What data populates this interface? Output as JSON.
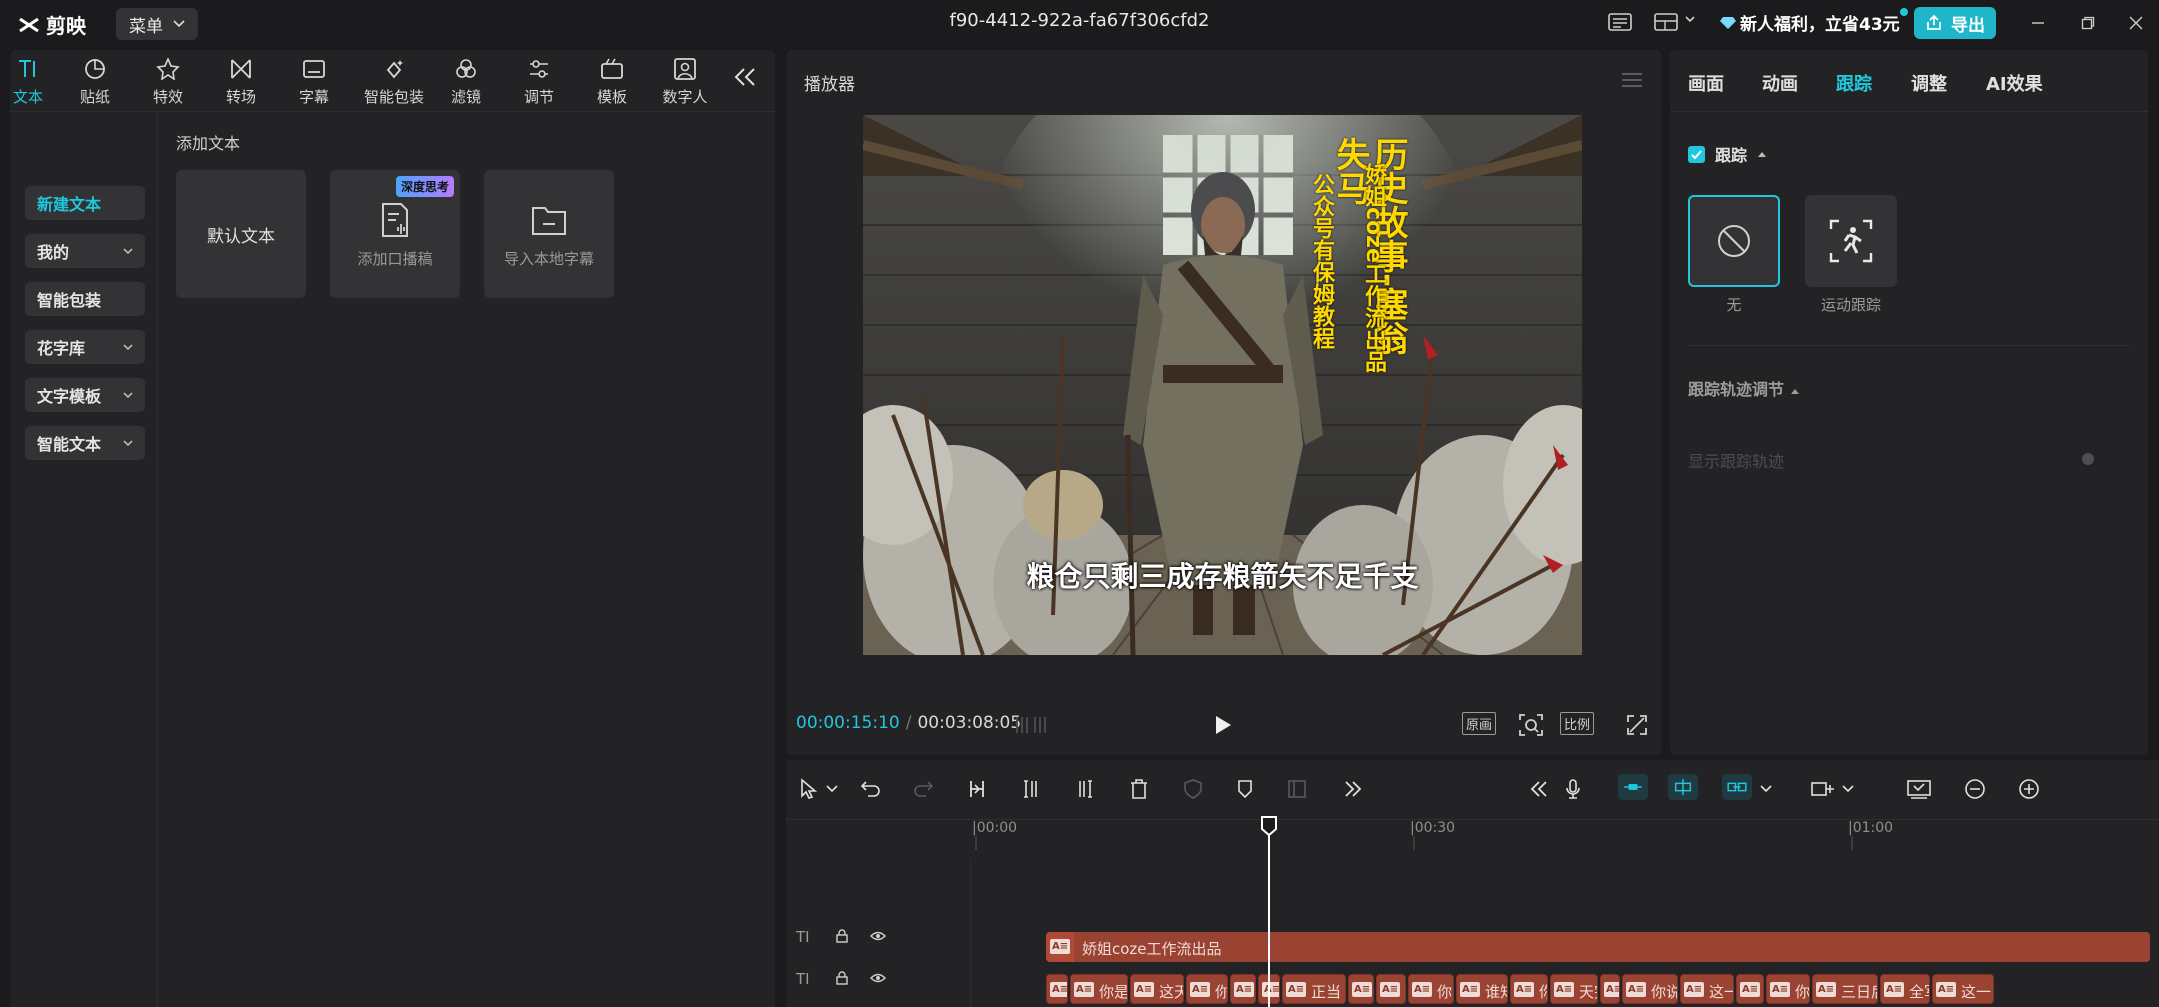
{
  "titlebar": {
    "app_name": "剪映",
    "menu_label": "菜单",
    "project_title": "f90-4412-922a-fa67f306cfd2",
    "welfare_text": "新人福利，立省43元",
    "export_label": "导出"
  },
  "tools": [
    {
      "label": "文本",
      "icon": "text-icon",
      "active": true
    },
    {
      "label": "贴纸",
      "icon": "sticker-icon"
    },
    {
      "label": "特效",
      "icon": "effects-icon"
    },
    {
      "label": "转场",
      "icon": "transition-icon"
    },
    {
      "label": "字幕",
      "icon": "subtitle-icon"
    },
    {
      "label": "智能包装",
      "icon": "smart-pack-icon"
    },
    {
      "label": "滤镜",
      "icon": "filter-icon"
    },
    {
      "label": "调节",
      "icon": "adjust-icon"
    },
    {
      "label": "模板",
      "icon": "template-icon"
    },
    {
      "label": "数字人",
      "icon": "digital-human-icon"
    }
  ],
  "categories": [
    {
      "label": "新建文本",
      "active": true
    },
    {
      "label": "我的",
      "dropdown": true
    },
    {
      "label": "智能包装"
    },
    {
      "label": "花字库",
      "dropdown": true
    },
    {
      "label": "文字模板",
      "dropdown": true
    },
    {
      "label": "智能文本",
      "dropdown": true
    }
  ],
  "content": {
    "section_title": "添加文本",
    "cards": [
      {
        "label": "默认文本"
      },
      {
        "label": "添加口播稿",
        "badge": "深度思考"
      },
      {
        "label": "导入本地字幕"
      }
    ]
  },
  "player": {
    "title": "播放器",
    "current_time": "00:00:15:10",
    "total_time": "00:03:08:05",
    "original_label": "原画",
    "ratio_label": "比例",
    "video": {
      "title_main": "历史故事-塞翁失马",
      "title_side1": "娇姐coze工作流出品",
      "title_side2": "公众号有保姆教程",
      "subtitle": "粮仓只剩三成存粮箭矢不足千支"
    }
  },
  "right_panel": {
    "tabs": [
      {
        "label": "画面"
      },
      {
        "label": "动画"
      },
      {
        "label": "跟踪",
        "active": true
      },
      {
        "label": "调整"
      },
      {
        "label": "AI效果"
      }
    ],
    "tracking_label": "跟踪",
    "options": [
      {
        "label": "无",
        "selected": true
      },
      {
        "label": "运动跟踪"
      }
    ],
    "track_adjust_title": "跟踪轨迹调节",
    "show_track_label": "显示跟踪轨迹"
  },
  "timeline": {
    "ruler_labels": [
      "00:00",
      "00:30",
      "01:00"
    ],
    "track1_clip": "娇姐coze工作流出品",
    "track2_segments": [
      "",
      "你是",
      "这天",
      "你",
      "",
      "",
      "正当",
      "",
      "",
      "你",
      "谁知",
      "你",
      "天完",
      "",
      "你说",
      "这一",
      "",
      "你",
      "三日后",
      "全军",
      "这一"
    ]
  },
  "colors": {
    "accent": "#1fc8dc",
    "clip": "#9a4332",
    "video_title": "#ffd800"
  }
}
